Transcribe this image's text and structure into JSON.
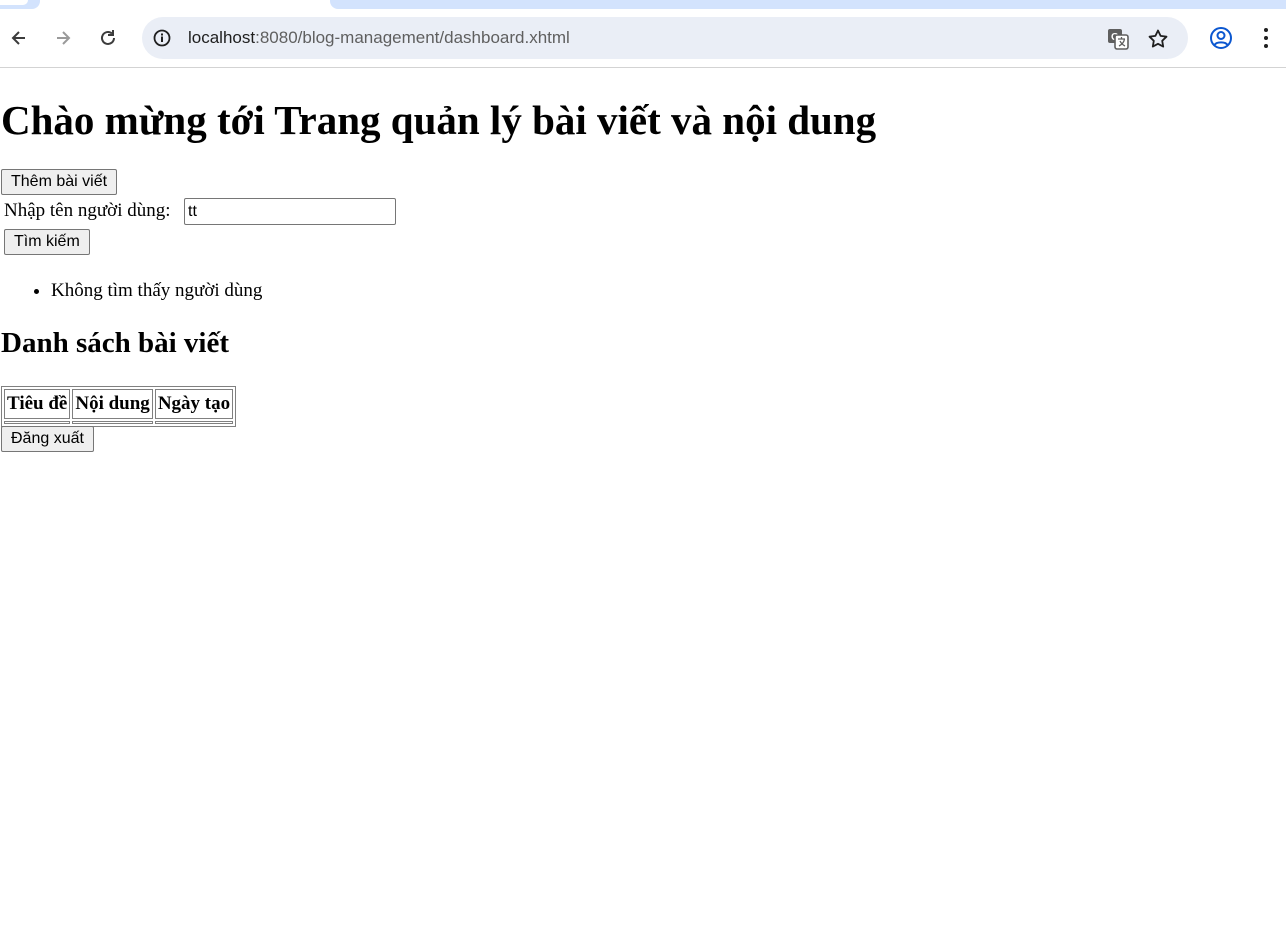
{
  "browser": {
    "url_host": "localhost",
    "url_rest": ":8080/blog-management/dashboard.xhtml"
  },
  "page": {
    "title": "Chào mừng tới Trang quản lý bài viết và nội dung",
    "add_post_label": "Thêm bài viết",
    "search_label": "Nhập tên người dùng:",
    "search_value": "tt",
    "search_button_label": "Tìm kiếm",
    "messages": [
      "Không tìm thấy người dùng"
    ],
    "section_title": "Danh sách bài viết",
    "table": {
      "headers": [
        "Tiêu đề",
        "Nội dung",
        "Ngày tạo"
      ],
      "rows": []
    },
    "logout_label": "Đăng xuất"
  }
}
